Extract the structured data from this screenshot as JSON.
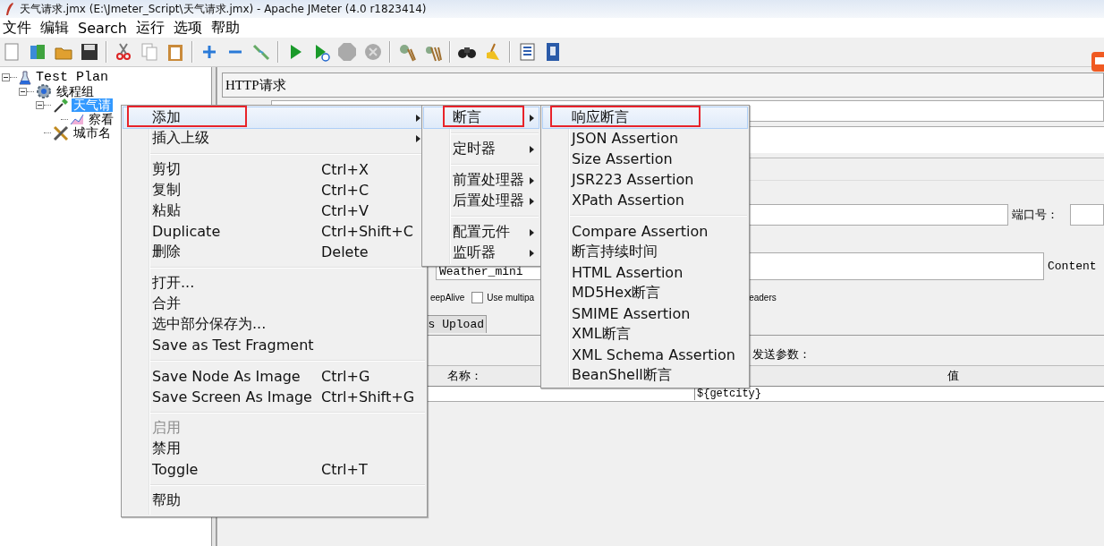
{
  "window": {
    "title": "天气请求.jmx (E:\\Jmeter_Script\\天气请求.jmx) - Apache JMeter (4.0 r1823414)"
  },
  "menu_bar": [
    "文件",
    "编辑",
    "Search",
    "运行",
    "选项",
    "帮助"
  ],
  "tree": [
    {
      "label": "Test Plan",
      "kind": "plan",
      "selected": false,
      "expanded": true,
      "children": [
        {
          "label": "线程组",
          "kind": "thread-group",
          "selected": false,
          "expanded": true,
          "children": [
            {
              "label": "天气请",
              "kind": "sampler",
              "selected": true,
              "expanded": true,
              "children": [
                {
                  "label": "察看",
                  "kind": "listener",
                  "selected": false
                }
              ]
            },
            {
              "label": "城市名",
              "kind": "config",
              "selected": false
            }
          ]
        }
      ]
    }
  ],
  "panel": {
    "title": "HTTP请求",
    "port_label": "端口号：",
    "path_value": "Weather_mini",
    "content_label": "Content",
    "options": [
      {
        "kind": "label",
        "label": "eepAlive"
      },
      {
        "kind": "checkbox",
        "label": "Use multipa",
        "checked": false
      },
      {
        "kind": "label",
        "label": "eaders"
      }
    ],
    "tab": "s Upload",
    "params_label": "发送参数：",
    "columns": [
      "名称：",
      "值"
    ],
    "rows": [
      {
        "value": "${getcity}"
      }
    ]
  },
  "context_menu": {
    "items": [
      {
        "kind": "item",
        "label": "添加",
        "submenu": true,
        "disabled": false,
        "selected": true,
        "marked": true
      },
      {
        "kind": "item",
        "label": "插入上级",
        "submenu": true,
        "disabled": false,
        "selected": false,
        "marked": false
      },
      {
        "kind": "separator"
      },
      {
        "kind": "item",
        "label": "剪切",
        "shortcut": "Ctrl+X",
        "submenu": false,
        "disabled": false,
        "selected": false,
        "marked": false
      },
      {
        "kind": "item",
        "label": "复制",
        "shortcut": "Ctrl+C",
        "submenu": false,
        "disabled": false,
        "selected": false,
        "marked": false
      },
      {
        "kind": "item",
        "label": "粘贴",
        "shortcut": "Ctrl+V",
        "submenu": false,
        "disabled": false,
        "selected": false,
        "marked": false
      },
      {
        "kind": "item",
        "label": "Duplicate",
        "shortcut": "Ctrl+Shift+C",
        "submenu": false,
        "disabled": false,
        "selected": false,
        "marked": false
      },
      {
        "kind": "item",
        "label": "删除",
        "shortcut": "Delete",
        "submenu": false,
        "disabled": false,
        "selected": false,
        "marked": false
      },
      {
        "kind": "separator"
      },
      {
        "kind": "item",
        "label": "打开...",
        "submenu": false,
        "disabled": false,
        "selected": false,
        "marked": false
      },
      {
        "kind": "item",
        "label": "合并",
        "submenu": false,
        "disabled": false,
        "selected": false,
        "marked": false
      },
      {
        "kind": "item",
        "label": "选中部分保存为...",
        "submenu": false,
        "disabled": false,
        "selected": false,
        "marked": false
      },
      {
        "kind": "item",
        "label": "Save as Test Fragment",
        "submenu": false,
        "disabled": false,
        "selected": false,
        "marked": false
      },
      {
        "kind": "separator"
      },
      {
        "kind": "item",
        "label": "Save Node As Image",
        "shortcut": "Ctrl+G",
        "submenu": false,
        "disabled": false,
        "selected": false,
        "marked": false
      },
      {
        "kind": "item",
        "label": "Save Screen As Image",
        "shortcut": "Ctrl+Shift+G",
        "submenu": false,
        "disabled": false,
        "selected": false,
        "marked": false
      },
      {
        "kind": "separator"
      },
      {
        "kind": "item",
        "label": "启用",
        "submenu": false,
        "disabled": true,
        "selected": false,
        "marked": false
      },
      {
        "kind": "item",
        "label": "禁用",
        "submenu": false,
        "disabled": false,
        "selected": false,
        "marked": false
      },
      {
        "kind": "item",
        "label": "Toggle",
        "shortcut": "Ctrl+T",
        "submenu": false,
        "disabled": false,
        "selected": false,
        "marked": false
      },
      {
        "kind": "separator"
      },
      {
        "kind": "item",
        "label": "帮助",
        "submenu": false,
        "disabled": false,
        "selected": false,
        "marked": false
      }
    ]
  },
  "add_menu": {
    "items": [
      {
        "kind": "item",
        "label": "断言",
        "submenu": true,
        "selected": true,
        "marked": true
      },
      {
        "kind": "separator"
      },
      {
        "kind": "item",
        "label": "定时器",
        "submenu": true,
        "selected": false,
        "marked": false
      },
      {
        "kind": "separator"
      },
      {
        "kind": "item",
        "label": "前置处理器",
        "submenu": true,
        "selected": false,
        "marked": false
      },
      {
        "kind": "item",
        "label": "后置处理器",
        "submenu": true,
        "selected": false,
        "marked": false
      },
      {
        "kind": "separator"
      },
      {
        "kind": "item",
        "label": "配置元件",
        "submenu": true,
        "selected": false,
        "marked": false
      },
      {
        "kind": "item",
        "label": "监听器",
        "submenu": true,
        "selected": false,
        "marked": false
      }
    ]
  },
  "assertion_menu": {
    "items": [
      {
        "kind": "item",
        "label": "响应断言",
        "selected": true,
        "marked": true
      },
      {
        "kind": "item",
        "label": "JSON Assertion",
        "selected": false,
        "marked": false
      },
      {
        "kind": "item",
        "label": "Size Assertion",
        "selected": false,
        "marked": false
      },
      {
        "kind": "item",
        "label": "JSR223 Assertion",
        "selected": false,
        "marked": false
      },
      {
        "kind": "item",
        "label": "XPath Assertion",
        "selected": false,
        "marked": false
      },
      {
        "kind": "separator"
      },
      {
        "kind": "item",
        "label": "Compare Assertion",
        "selected": false,
        "marked": false
      },
      {
        "kind": "item",
        "label": "断言持续时间",
        "selected": false,
        "marked": false
      },
      {
        "kind": "item",
        "label": "HTML Assertion",
        "selected": false,
        "marked": false
      },
      {
        "kind": "item",
        "label": "MD5Hex断言",
        "selected": false,
        "marked": false
      },
      {
        "kind": "item",
        "label": "SMIME Assertion",
        "selected": false,
        "marked": false
      },
      {
        "kind": "item",
        "label": "XML断言",
        "selected": false,
        "marked": false
      },
      {
        "kind": "item",
        "label": "XML Schema Assertion",
        "selected": false,
        "marked": false
      },
      {
        "kind": "item",
        "label": "BeanShell断言",
        "selected": false,
        "marked": false
      }
    ]
  }
}
